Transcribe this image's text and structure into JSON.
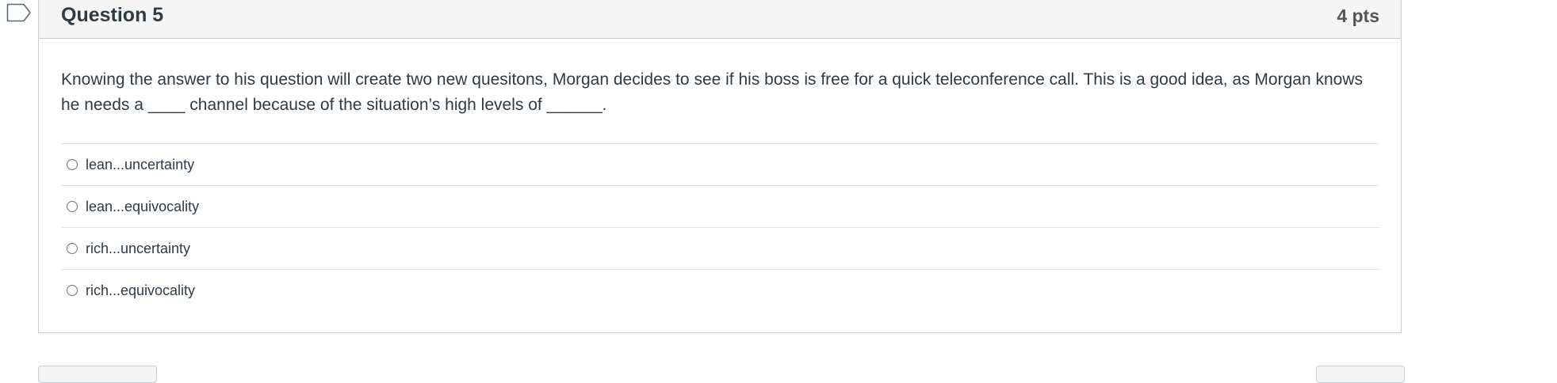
{
  "question": {
    "title": "Question 5",
    "points": "4 pts",
    "text": "Knowing the answer to his question will create two new quesitons, Morgan decides to see if his boss is free for a quick teleconference call. This is a good idea, as Morgan knows he needs a ____ channel because of the situation’s high levels of ______.",
    "answers": [
      {
        "label": "lean...uncertainty"
      },
      {
        "label": "lean...equivocality"
      },
      {
        "label": "rich...uncertainty"
      },
      {
        "label": "rich...equivocality"
      }
    ]
  },
  "icons": {
    "flag": "bookmark-flag-icon",
    "radio": "radio-button-icon"
  },
  "colors": {
    "text": "#2d3b45",
    "header_bg": "#f5f5f5",
    "border": "#c7cdd1",
    "points": "#555555"
  }
}
